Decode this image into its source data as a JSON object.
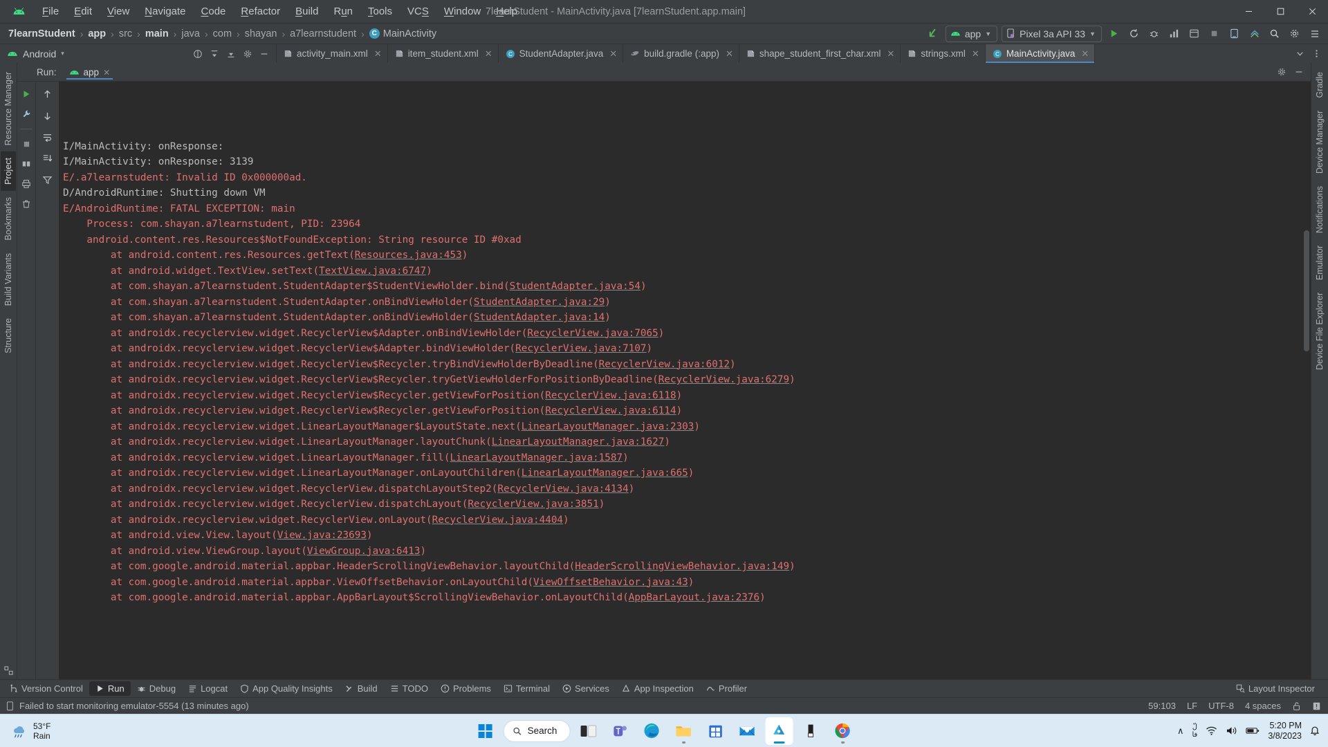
{
  "window": {
    "title": "7learnStudent - MainActivity.java [7learnStudent.app.main]",
    "minimize": "—",
    "maximize": "❐",
    "close": "✕"
  },
  "menu": {
    "items": [
      {
        "label": "File",
        "mnemonic": "F"
      },
      {
        "label": "Edit",
        "mnemonic": "E"
      },
      {
        "label": "View",
        "mnemonic": "V"
      },
      {
        "label": "Navigate",
        "mnemonic": "N"
      },
      {
        "label": "Code",
        "mnemonic": "C"
      },
      {
        "label": "Refactor",
        "mnemonic": "R"
      },
      {
        "label": "Build",
        "mnemonic": "B"
      },
      {
        "label": "Run",
        "mnemonic": "u"
      },
      {
        "label": "Tools",
        "mnemonic": "T"
      },
      {
        "label": "VCS",
        "mnemonic": "S"
      },
      {
        "label": "Window",
        "mnemonic": "W"
      },
      {
        "label": "Help",
        "mnemonic": "H"
      }
    ]
  },
  "navbar": {
    "breadcrumbs": [
      {
        "label": "7learnStudent",
        "style": "bold"
      },
      {
        "label": "app",
        "style": "bold"
      },
      {
        "label": "src",
        "style": "dim"
      },
      {
        "label": "main",
        "style": "bold"
      },
      {
        "label": "java",
        "style": "dim"
      },
      {
        "label": "com",
        "style": "dim"
      },
      {
        "label": "shayan",
        "style": "dim"
      },
      {
        "label": "a7learnstudent",
        "style": "dim"
      }
    ],
    "separator": "›",
    "class_badge": "C",
    "class_name": "MainActivity",
    "run_config": "app",
    "device": "Pixel 3a API 33",
    "icons": {
      "back": "back-arrow-icon",
      "run": "run-icon",
      "debug": "debug-icon",
      "coverage": "coverage-icon",
      "profile": "profile-icon",
      "apply_changes": "apply-changes-icon",
      "stop": "stop-icon",
      "avd": "device-manager-icon",
      "sdk": "sdk-manager-icon",
      "search": "search-icon",
      "settings": "settings-icon",
      "menu": "hamburger-icon"
    }
  },
  "project_pane": {
    "label": "Android",
    "dropdown_caret": "▾"
  },
  "editor_tabs": [
    {
      "label": "activity_main.xml",
      "icon": "xml-layout-icon",
      "active": false
    },
    {
      "label": "item_student.xml",
      "icon": "xml-layout-icon",
      "active": false
    },
    {
      "label": "StudentAdapter.java",
      "icon": "java-class-icon",
      "active": false
    },
    {
      "label": "build.gradle (:app)",
      "icon": "gradle-icon",
      "active": false
    },
    {
      "label": "shape_student_first_char.xml",
      "icon": "xml-layout-icon",
      "active": false
    },
    {
      "label": "strings.xml",
      "icon": "xml-values-icon",
      "active": false
    },
    {
      "label": "MainActivity.java",
      "icon": "java-class-icon",
      "active": true
    }
  ],
  "left_rail": [
    {
      "label": "Resource Manager",
      "selected": false
    },
    {
      "label": "Project",
      "selected": true
    },
    {
      "label": "Bookmarks",
      "selected": false
    },
    {
      "label": "Build Variants",
      "selected": false
    },
    {
      "label": "Structure",
      "selected": false
    }
  ],
  "right_rail": [
    {
      "label": "Gradle",
      "selected": false
    },
    {
      "label": "Device Manager",
      "selected": false
    },
    {
      "label": "Notifications",
      "selected": false
    },
    {
      "label": "Emulator",
      "selected": false
    },
    {
      "label": "Device File Explorer",
      "selected": false
    }
  ],
  "run_panel": {
    "header_label": "Run:",
    "tab_label": "app",
    "tab_close": "✕",
    "gutter_actions": [
      "rerun-icon",
      "settings-wrench-icon",
      "stop-icon",
      "layout-icon",
      "print-icon",
      "trash-icon"
    ],
    "console_actions": [
      "scroll-up-icon",
      "scroll-down-icon",
      "soft-wrap-icon",
      "scroll-to-end-icon",
      "filter-icon"
    ]
  },
  "console": {
    "lines": [
      {
        "text": "I/MainActivity: onResponse:",
        "level": "info"
      },
      {
        "text": "I/MainActivity: onResponse: 3139",
        "level": "info"
      },
      {
        "text": "E/.a7learnstudent: Invalid ID 0x000000ad.",
        "level": "error"
      },
      {
        "text": "D/AndroidRuntime: Shutting down VM",
        "level": "info"
      },
      {
        "text": "E/AndroidRuntime: FATAL EXCEPTION: main",
        "level": "error"
      },
      {
        "text": "    Process: com.shayan.a7learnstudent, PID: 23964",
        "level": "error"
      },
      {
        "text": "    android.content.res.Resources$NotFoundException: String resource ID #0xad",
        "level": "error"
      },
      {
        "text": "        at android.content.res.Resources.getText(",
        "link": "Resources.java:453",
        "tail": ")",
        "level": "error"
      },
      {
        "text": "        at android.widget.TextView.setText(",
        "link": "TextView.java:6747",
        "tail": ")",
        "level": "error"
      },
      {
        "text": "        at com.shayan.a7learnstudent.StudentAdapter$StudentViewHolder.bind(",
        "link": "StudentAdapter.java:54",
        "tail": ")",
        "level": "error"
      },
      {
        "text": "        at com.shayan.a7learnstudent.StudentAdapter.onBindViewHolder(",
        "link": "StudentAdapter.java:29",
        "tail": ")",
        "level": "error"
      },
      {
        "text": "        at com.shayan.a7learnstudent.StudentAdapter.onBindViewHolder(",
        "link": "StudentAdapter.java:14",
        "tail": ")",
        "level": "error"
      },
      {
        "text": "        at androidx.recyclerview.widget.RecyclerView$Adapter.onBindViewHolder(",
        "link": "RecyclerView.java:7065",
        "tail": ")",
        "level": "error"
      },
      {
        "text": "        at androidx.recyclerview.widget.RecyclerView$Adapter.bindViewHolder(",
        "link": "RecyclerView.java:7107",
        "tail": ")",
        "level": "error"
      },
      {
        "text": "        at androidx.recyclerview.widget.RecyclerView$Recycler.tryBindViewHolderByDeadline(",
        "link": "RecyclerView.java:6012",
        "tail": ")",
        "level": "error"
      },
      {
        "text": "        at androidx.recyclerview.widget.RecyclerView$Recycler.tryGetViewHolderForPositionByDeadline(",
        "link": "RecyclerView.java:6279",
        "tail": ")",
        "level": "error"
      },
      {
        "text": "        at androidx.recyclerview.widget.RecyclerView$Recycler.getViewForPosition(",
        "link": "RecyclerView.java:6118",
        "tail": ")",
        "level": "error"
      },
      {
        "text": "        at androidx.recyclerview.widget.RecyclerView$Recycler.getViewForPosition(",
        "link": "RecyclerView.java:6114",
        "tail": ")",
        "level": "error"
      },
      {
        "text": "        at androidx.recyclerview.widget.LinearLayoutManager$LayoutState.next(",
        "link": "LinearLayoutManager.java:2303",
        "tail": ")",
        "level": "error"
      },
      {
        "text": "        at androidx.recyclerview.widget.LinearLayoutManager.layoutChunk(",
        "link": "LinearLayoutManager.java:1627",
        "tail": ")",
        "level": "error"
      },
      {
        "text": "        at androidx.recyclerview.widget.LinearLayoutManager.fill(",
        "link": "LinearLayoutManager.java:1587",
        "tail": ")",
        "level": "error"
      },
      {
        "text": "        at androidx.recyclerview.widget.LinearLayoutManager.onLayoutChildren(",
        "link": "LinearLayoutManager.java:665",
        "tail": ")",
        "level": "error"
      },
      {
        "text": "        at androidx.recyclerview.widget.RecyclerView.dispatchLayoutStep2(",
        "link": "RecyclerView.java:4134",
        "tail": ")",
        "level": "error"
      },
      {
        "text": "        at androidx.recyclerview.widget.RecyclerView.dispatchLayout(",
        "link": "RecyclerView.java:3851",
        "tail": ")",
        "level": "error"
      },
      {
        "text": "        at androidx.recyclerview.widget.RecyclerView.onLayout(",
        "link": "RecyclerView.java:4404",
        "tail": ")",
        "level": "error"
      },
      {
        "text": "        at android.view.View.layout(",
        "link": "View.java:23693",
        "tail": ")",
        "level": "error"
      },
      {
        "text": "        at android.view.ViewGroup.layout(",
        "link": "ViewGroup.java:6413",
        "tail": ")",
        "level": "error"
      },
      {
        "text": "        at com.google.android.material.appbar.HeaderScrollingViewBehavior.layoutChild(",
        "link": "HeaderScrollingViewBehavior.java:149",
        "tail": ")",
        "level": "error"
      },
      {
        "text": "        at com.google.android.material.appbar.ViewOffsetBehavior.onLayoutChild(",
        "link": "ViewOffsetBehavior.java:43",
        "tail": ")",
        "level": "error"
      },
      {
        "text": "        at com.google.android.material.appbar.AppBarLayout$ScrollingViewBehavior.onLayoutChild(",
        "link": "AppBarLayout.java:2376",
        "tail": ")",
        "level": "error"
      }
    ]
  },
  "tool_windows": [
    {
      "label": "Version Control",
      "icon": "branch-icon",
      "selected": false
    },
    {
      "label": "Run",
      "icon": "run-icon",
      "selected": true
    },
    {
      "label": "Debug",
      "icon": "debug-icon",
      "selected": false
    },
    {
      "label": "Logcat",
      "icon": "logcat-icon",
      "selected": false
    },
    {
      "label": "App Quality Insights",
      "icon": "shield-icon",
      "selected": false
    },
    {
      "label": "Build",
      "icon": "hammer-icon",
      "selected": false
    },
    {
      "label": "TODO",
      "icon": "list-icon",
      "selected": false
    },
    {
      "label": "Problems",
      "icon": "warning-icon",
      "selected": false
    },
    {
      "label": "Terminal",
      "icon": "terminal-icon",
      "selected": false
    },
    {
      "label": "Services",
      "icon": "services-icon",
      "selected": false
    },
    {
      "label": "App Inspection",
      "icon": "inspection-icon",
      "selected": false
    },
    {
      "label": "Profiler",
      "icon": "profiler-icon",
      "selected": false
    }
  ],
  "tool_windows_right": {
    "layout_inspector": "Layout Inspector"
  },
  "status_bar": {
    "message": "Failed to start monitoring emulator-5554 (13 minutes ago)",
    "caret": "59:103",
    "line_sep": "LF",
    "encoding": "UTF-8",
    "indent": "4 spaces",
    "lock_icon": "unlocked-icon",
    "notify_icon": "notification-icon"
  },
  "taskbar": {
    "weather_temp": "53°F",
    "weather_desc": "Rain",
    "search_label": "Search",
    "apps": [
      {
        "name": "start-button",
        "icon": "windows-logo-icon"
      },
      {
        "name": "taskview-button",
        "icon": "task-view-icon"
      },
      {
        "name": "teams-button",
        "icon": "teams-icon"
      },
      {
        "name": "edge-button",
        "icon": "edge-icon"
      },
      {
        "name": "explorer-button",
        "icon": "file-explorer-icon"
      },
      {
        "name": "store-button",
        "icon": "microsoft-store-icon"
      },
      {
        "name": "mail-button",
        "icon": "mail-icon"
      },
      {
        "name": "androidstudio-button",
        "icon": "android-studio-icon"
      },
      {
        "name": "keepass-button",
        "icon": "keepass-icon"
      },
      {
        "name": "chrome-button",
        "icon": "chrome-icon"
      }
    ],
    "lang": "فا",
    "lang_top": "لّ",
    "time": "5:20 PM",
    "date": "3/8/2023",
    "chevron": "∧"
  }
}
